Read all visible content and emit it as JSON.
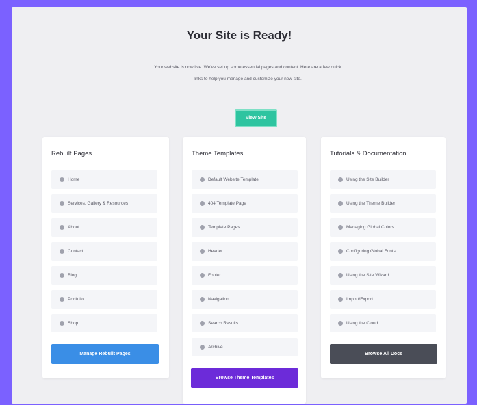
{
  "header": {
    "title": "Your Site is Ready!",
    "description": "Your website is now live. We've set up some essential pages and content. Here are a few quick links to help you manage and customize your new site.",
    "view_button": "View Site"
  },
  "cards": [
    {
      "title": "Rebuilt Pages",
      "items": [
        "Home",
        "Services, Gallery & Resources",
        "About",
        "Contact",
        "Blog",
        "Portfolio",
        "Shop"
      ],
      "button": "Manage Rebuilt Pages",
      "button_color": "#3a8ee6"
    },
    {
      "title": "Theme Templates",
      "items": [
        "Default Website Template",
        "404 Template Page",
        "Template Pages",
        "Header",
        "Footer",
        "Navigation",
        "Search Results",
        "Archive"
      ],
      "button": "Browse Theme Templates",
      "button_color": "#6c2bd9"
    },
    {
      "title": "Tutorials & Documentation",
      "items": [
        "Using the Site Builder",
        "Using the Theme Builder",
        "Managing Global Colors",
        "Configuring Global Fonts",
        "Using the Site Wizard",
        "Import/Export",
        "Using the Cloud"
      ],
      "button": "Browse All Docs",
      "button_color": "#4a4d57"
    }
  ]
}
